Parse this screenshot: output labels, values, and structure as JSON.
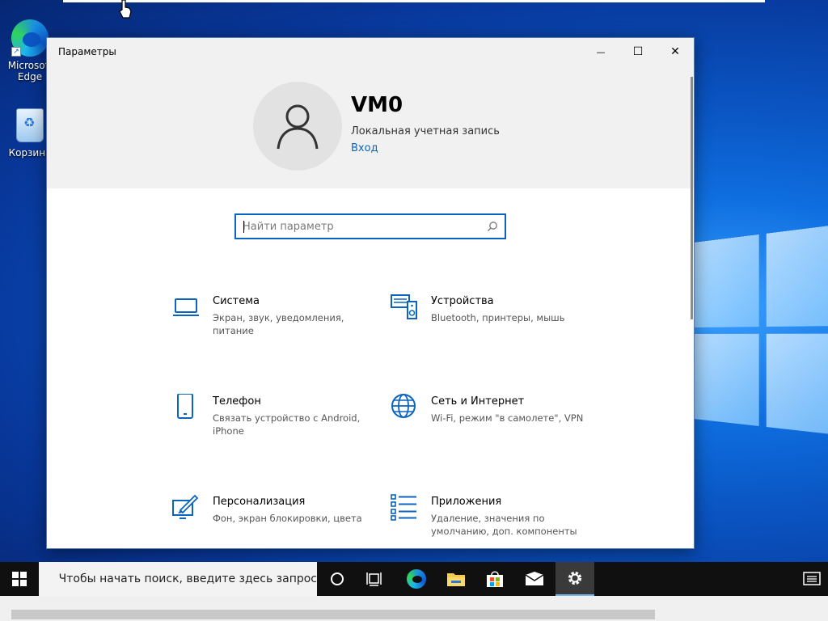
{
  "desktop": {
    "icons": [
      {
        "label": "Microsoft Edge"
      },
      {
        "label": "Корзина"
      }
    ]
  },
  "window": {
    "title": "Параметры",
    "controls": {
      "minimize": "—",
      "maximize": "☐",
      "close": "✕"
    },
    "user": {
      "name": "VM0",
      "account_type": "Локальная учетная запись",
      "login_link": "Вход"
    },
    "search": {
      "placeholder": "Найти параметр"
    },
    "categories": [
      {
        "name": "Система",
        "desc": "Экран, звук, уведомления, питание",
        "icon": "laptop-icon"
      },
      {
        "name": "Устройства",
        "desc": "Bluetooth, принтеры, мышь",
        "icon": "devices-icon"
      },
      {
        "name": "Телефон",
        "desc": "Связать устройство с Android, iPhone",
        "icon": "phone-icon"
      },
      {
        "name": "Сеть и Интернет",
        "desc": "Wi-Fi, режим \"в самолете\", VPN",
        "icon": "globe-icon"
      },
      {
        "name": "Персонализация",
        "desc": "Фон, экран блокировки, цвета",
        "icon": "paint-icon"
      },
      {
        "name": "Приложения",
        "desc": "Удаление, значения по умолчанию, доп. компоненты",
        "icon": "apps-list-icon"
      }
    ]
  },
  "taskbar": {
    "search_placeholder": "Чтобы начать поиск, введите здесь запрос",
    "colors": {
      "accent": "#0a64c0",
      "taskbar": "#101010"
    }
  }
}
